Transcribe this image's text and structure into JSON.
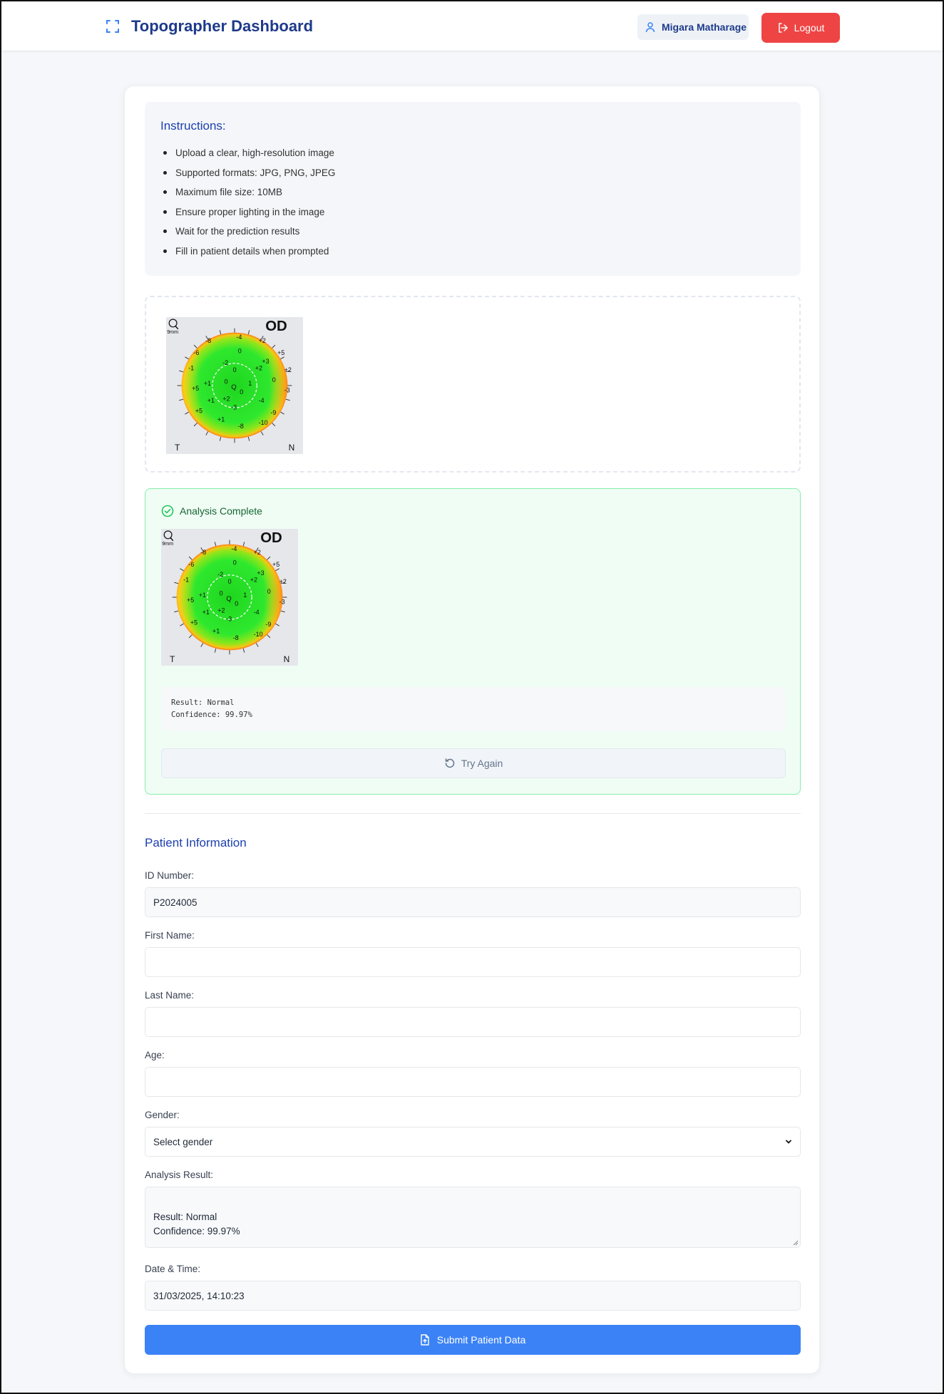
{
  "header": {
    "title": "Topographer Dashboard",
    "user_name": "Migara Matharage",
    "logout_label": "Logout"
  },
  "instructions": {
    "title": "Instructions:",
    "items": [
      "Upload a clear, high-resolution image",
      "Supported formats: JPG, PNG, JPEG",
      "Maximum file size: 10MB",
      "Ensure proper lighting in the image",
      "Wait for the prediction results",
      "Fill in patient details when prompted"
    ]
  },
  "topography": {
    "eye": "OD",
    "scale": "9mm",
    "left_marker": "T",
    "right_marker": "N",
    "center_label": "Q",
    "values": [
      "-8",
      "-4",
      "+2",
      "-6",
      "0",
      "+3",
      "+5",
      "-1",
      "-2",
      "0",
      "+2",
      "+2",
      "0",
      "1",
      "0",
      "+1",
      "+5",
      "-3",
      "+1",
      "0",
      "+2",
      "-4",
      "-9",
      "+5",
      "-3",
      "+1",
      "-8",
      "-10"
    ]
  },
  "analysis": {
    "status": "Analysis Complete",
    "result_line": "Result: Normal",
    "confidence_line": "Confidence: 99.97%",
    "try_again_label": "Try Again"
  },
  "patient": {
    "section_title": "Patient Information",
    "id_label": "ID Number:",
    "id_value": "P2024005",
    "first_name_label": "First Name:",
    "last_name_label": "Last Name:",
    "age_label": "Age:",
    "gender_label": "Gender:",
    "gender_selected": "Select gender",
    "result_label": "Analysis Result:",
    "result_value": "Result: Normal\nConfidence: 99.97%",
    "datetime_label": "Date & Time:",
    "datetime_value": "31/03/2025, 14:10:23",
    "submit_label": "Submit Patient Data"
  },
  "colors": {
    "brand": "#1e3a8a",
    "logout": "#ef4444",
    "submit": "#3b82f6",
    "success": "#16a34a"
  }
}
